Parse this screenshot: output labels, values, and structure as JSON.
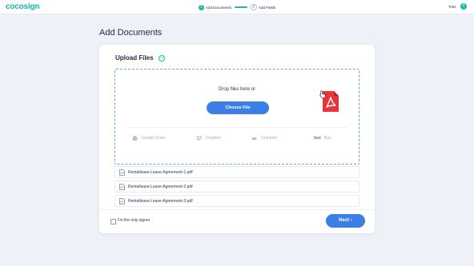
{
  "header": {
    "logo": "cocosign",
    "steps": [
      {
        "number": "1",
        "label": "Add Documents",
        "active": true
      },
      {
        "number": "2",
        "label": "Add Fields",
        "active": false
      }
    ],
    "user_name": "Toke",
    "user_initial": "T"
  },
  "page_title": "Add Documents",
  "upload": {
    "title": "Upload Files",
    "help_icon": "?",
    "drop_text": "Drop files here or",
    "choose_label": "Choose File",
    "providers": [
      {
        "name": "Google Drive",
        "icon": "google-drive-icon"
      },
      {
        "name": "Dropbox",
        "icon": "dropbox-icon"
      },
      {
        "name": "Onedrive",
        "icon": "onedrive-icon"
      },
      {
        "name": "Box",
        "icon": "box-icon",
        "logo_text": "box"
      }
    ]
  },
  "files": [
    "Rentallease-Lease-Agreement-1.pdf",
    "Rentallease-Lease-Agreement-2.pdf",
    "Rentallease-Lease-Agreement-3.pdf"
  ],
  "footer": {
    "only_signer_label": "I'm the only signer",
    "only_signer_checked": false,
    "next_label": "Next ›"
  },
  "colors": {
    "accent": "#16b8ac",
    "primary_button": "#3b7fe6",
    "pdf_red": "#e8343a",
    "background": "#eef2f8"
  }
}
